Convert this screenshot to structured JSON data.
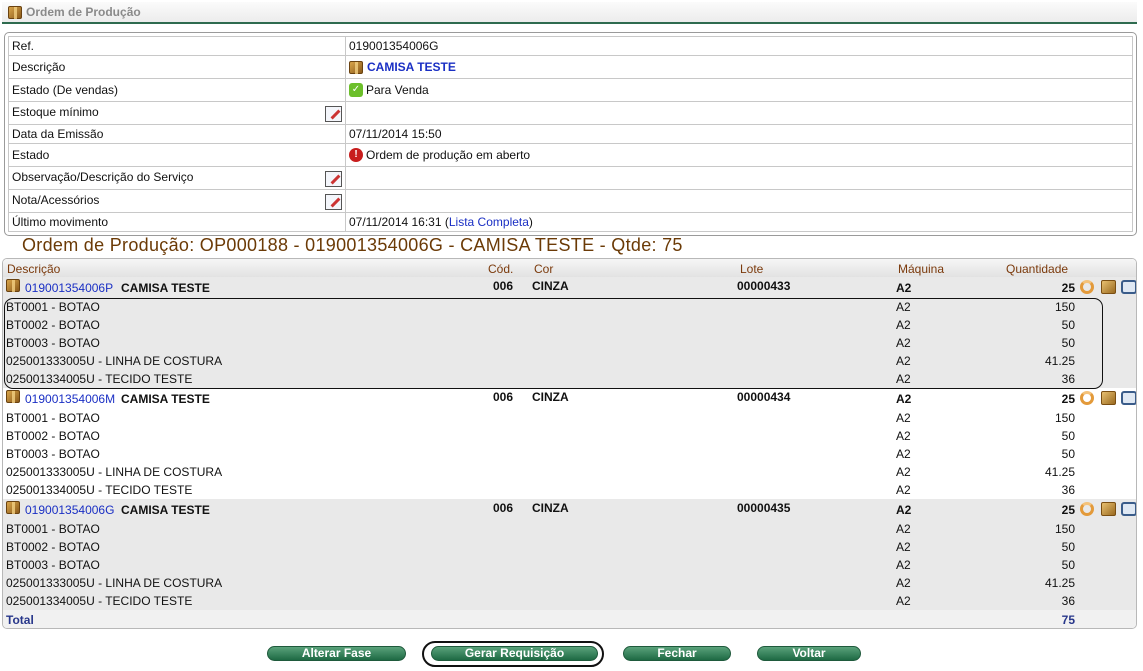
{
  "header": {
    "title": "Ordem de Produção"
  },
  "info": {
    "ref": {
      "label": "Ref.",
      "value": "019001354006G"
    },
    "descricao": {
      "label": "Descrição",
      "value": "CAMISA TESTE"
    },
    "estado_vendas": {
      "label": "Estado (De vendas)",
      "value": "Para Venda"
    },
    "estoque_minimo": {
      "label": "Estoque mínimo",
      "value": ""
    },
    "data_emissao": {
      "label": "Data da Emissão",
      "value": "07/11/2014 15:50"
    },
    "estado": {
      "label": "Estado",
      "value": "Ordem de produção em aberto"
    },
    "observacao": {
      "label": "Observação/Descrição do Serviço",
      "value": ""
    },
    "nota": {
      "label": "Nota/Acessórios",
      "value": ""
    },
    "ultimo_movimento": {
      "label": "Último movimento",
      "value": "07/11/2014 16:31",
      "open": "(",
      "link": "Lista Completa",
      "close": ")"
    }
  },
  "op_title": "Ordem de Produção: OP000188 - 019001354006G - CAMISA TESTE - Qtde: 75",
  "grid": {
    "headers": {
      "descricao": "Descrição",
      "cod": "Cód.",
      "cor": "Cor",
      "lote": "Lote",
      "maquina": "Máquina",
      "quantidade": "Quantidade"
    },
    "groups": [
      {
        "code": "019001354006P",
        "name": "CAMISA TESTE",
        "cod": "006",
        "cor": "CINZA",
        "lote": "00000433",
        "maquina": "A2",
        "quantidade": "25",
        "items": [
          {
            "desc": "BT0001 - BOTAO",
            "maquina": "A2",
            "quantidade": "150"
          },
          {
            "desc": "BT0002 - BOTAO",
            "maquina": "A2",
            "quantidade": "50"
          },
          {
            "desc": "BT0003 - BOTAO",
            "maquina": "A2",
            "quantidade": "50"
          },
          {
            "desc": "025001333005U - LINHA DE COSTURA",
            "maquina": "A2",
            "quantidade": "41.25"
          },
          {
            "desc": "025001334005U - TECIDO TESTE",
            "maquina": "A2",
            "quantidade": "36"
          }
        ]
      },
      {
        "code": "019001354006M",
        "name": "CAMISA TESTE",
        "cod": "006",
        "cor": "CINZA",
        "lote": "00000434",
        "maquina": "A2",
        "quantidade": "25",
        "items": [
          {
            "desc": "BT0001 - BOTAO",
            "maquina": "A2",
            "quantidade": "150"
          },
          {
            "desc": "BT0002 - BOTAO",
            "maquina": "A2",
            "quantidade": "50"
          },
          {
            "desc": "BT0003 - BOTAO",
            "maquina": "A2",
            "quantidade": "50"
          },
          {
            "desc": "025001333005U - LINHA DE COSTURA",
            "maquina": "A2",
            "quantidade": "41.25"
          },
          {
            "desc": "025001334005U - TECIDO TESTE",
            "maquina": "A2",
            "quantidade": "36"
          }
        ]
      },
      {
        "code": "019001354006G",
        "name": "CAMISA TESTE",
        "cod": "006",
        "cor": "CINZA",
        "lote": "00000435",
        "maquina": "A2",
        "quantidade": "25",
        "items": [
          {
            "desc": "BT0001 - BOTAO",
            "maquina": "A2",
            "quantidade": "150"
          },
          {
            "desc": "BT0002 - BOTAO",
            "maquina": "A2",
            "quantidade": "50"
          },
          {
            "desc": "BT0003 - BOTAO",
            "maquina": "A2",
            "quantidade": "50"
          },
          {
            "desc": "025001333005U - LINHA DE COSTURA",
            "maquina": "A2",
            "quantidade": "41.25"
          },
          {
            "desc": "025001334005U - TECIDO TESTE",
            "maquina": "A2",
            "quantidade": "36"
          }
        ]
      }
    ],
    "total": {
      "label": "Total",
      "value": "75"
    }
  },
  "buttons": {
    "alterar_fase": "Alterar Fase",
    "gerar_requisicao": "Gerar Requisição",
    "fechar": "Fechar",
    "voltar": "Voltar"
  },
  "icons": [
    "box-icon",
    "edit-icon",
    "check-icon",
    "alert-icon",
    "refresh-icon",
    "package-icon",
    "print-icon"
  ]
}
